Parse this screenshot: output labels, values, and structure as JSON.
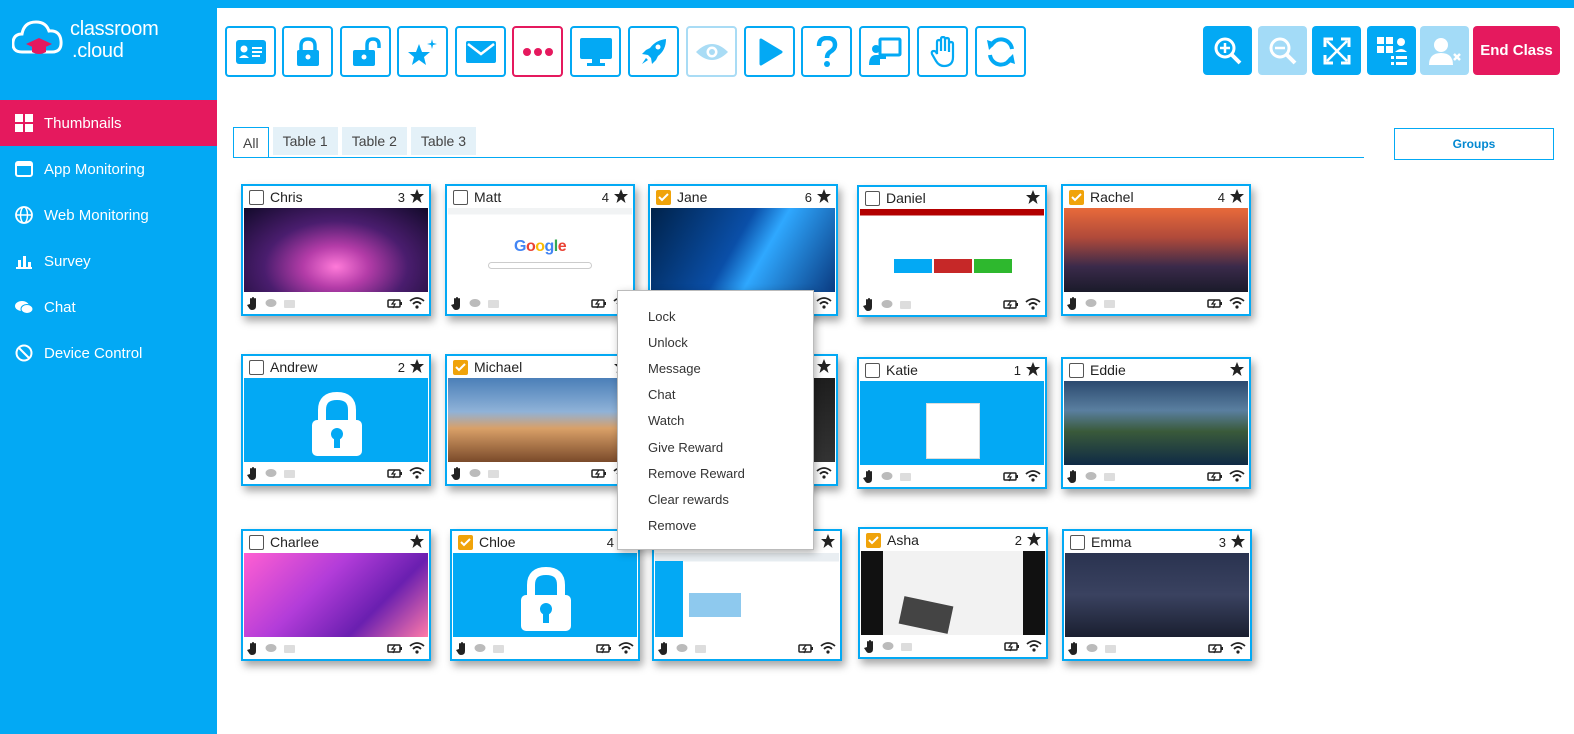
{
  "app": {
    "logo_text_1": "classroom",
    "logo_text_2": ".cloud",
    "accent": "#03a9f4",
    "brand_pink": "#e5195e"
  },
  "sidebar": {
    "items": [
      {
        "label": "Thumbnails",
        "icon": "grid-icon",
        "active": true
      },
      {
        "label": "App Monitoring",
        "icon": "window-icon"
      },
      {
        "label": "Web Monitoring",
        "icon": "globe-icon"
      },
      {
        "label": "Survey",
        "icon": "bar-chart-icon"
      },
      {
        "label": "Chat",
        "icon": "chat-icon"
      },
      {
        "label": "Device Control",
        "icon": "block-icon"
      }
    ]
  },
  "toolbar": {
    "left_buttons": [
      "register-icon",
      "lock-icon",
      "unlock-icon",
      "reward-icon",
      "message-icon",
      "more-icon",
      "monitor-icon",
      "launch-icon",
      "watch-icon",
      "play-icon",
      "help-icon",
      "present-icon",
      "hand-icon",
      "refresh-icon"
    ],
    "right_buttons": [
      "zoom-in-icon",
      "zoom-out-icon",
      "fit-icon",
      "group-list-icon",
      "remove-user-icon"
    ],
    "end_class_label": "End Class"
  },
  "tabs": [
    "All",
    "Table 1",
    "Table 2",
    "Table 3"
  ],
  "groups_label": "Groups",
  "students": [
    {
      "name": "Chris",
      "count": "3",
      "checked": false,
      "screen": "aurora"
    },
    {
      "name": "Matt",
      "count": "4",
      "checked": false,
      "screen": "google"
    },
    {
      "name": "Jane",
      "count": "6",
      "checked": true,
      "screen": "windows"
    },
    {
      "name": "Daniel",
      "count": "",
      "checked": false,
      "screen": "app"
    },
    {
      "name": "Rachel",
      "count": "4",
      "checked": true,
      "screen": "sierra"
    },
    {
      "name": "Andrew",
      "count": "2",
      "checked": false,
      "screen": "locked"
    },
    {
      "name": "Michael",
      "count": "",
      "checked": true,
      "screen": "mojave"
    },
    {
      "name": "",
      "count": "",
      "checked": false,
      "screen": "dark"
    },
    {
      "name": "Katie",
      "count": "1",
      "checked": false,
      "screen": "login"
    },
    {
      "name": "Eddie",
      "count": "",
      "checked": false,
      "screen": "catalina"
    },
    {
      "name": "Charlee",
      "count": "",
      "checked": false,
      "screen": "monterey"
    },
    {
      "name": "Chloe",
      "count": "4",
      "checked": true,
      "screen": "locked"
    },
    {
      "name": "",
      "count": "",
      "checked": false,
      "screen": "cloud"
    },
    {
      "name": "Asha",
      "count": "2",
      "checked": true,
      "screen": "photo"
    },
    {
      "name": "Emma",
      "count": "3",
      "checked": false,
      "screen": "night"
    }
  ],
  "context_menu": [
    "Lock",
    "Unlock",
    "Message",
    "Chat",
    "Watch",
    "Give Reward",
    "Remove Reward",
    "Clear rewards",
    "Remove"
  ]
}
